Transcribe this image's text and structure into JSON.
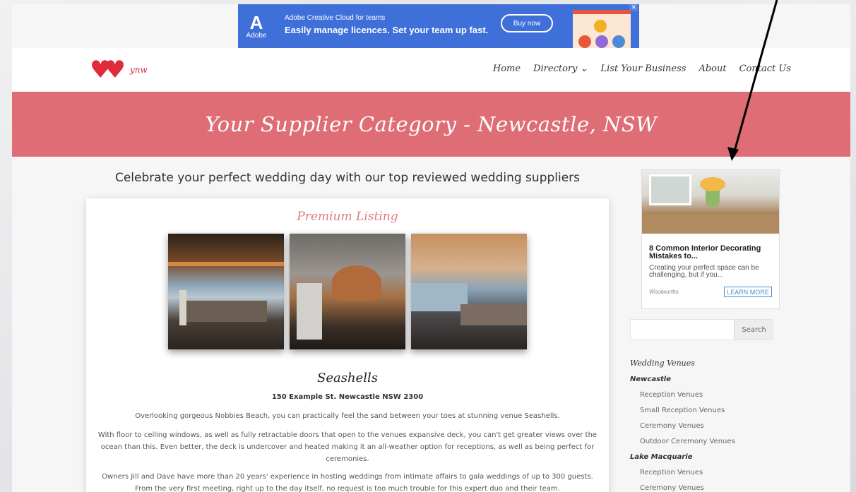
{
  "top_ad": {
    "logo_text": "Adobe",
    "line1": "Adobe Creative Cloud for teams",
    "line2": "Easily manage licences. Set your team up fast.",
    "button": "Buy now"
  },
  "header": {
    "brand_name": "ynw",
    "nav": [
      "Home",
      "Directory ⌄",
      "List Your Business",
      "About",
      "Contact Us"
    ]
  },
  "hero": {
    "title": "Your Supplier Category - Newcastle, NSW"
  },
  "main": {
    "tagline": "Celebrate your perfect wedding day with our top reviewed wedding suppliers",
    "listing": {
      "badge": "Premium Listing",
      "name": "Seashells",
      "address": "150 Example St. Newcastle NSW 2300",
      "paragraphs": [
        "Overlooking gorgeous Nobbies Beach, you can practically feel the sand between your toes at stunning venue Seashells.",
        "With floor to ceiling windows, as well as fully retractable doors that open to the venues expansive deck, you can't get greater views over the ocean than this. Even better, the deck is undercover and heated making it an all-weather option for receptions, as well as being perfect for ceremonies.",
        "Owners Jill and Dave have more than 20 years' experience in hosting weddings from intimate affairs to gala weddings of up to 300 guests. From the very first meeting, right up to the day itself, no request is too much trouble for this expert duo and their team."
      ]
    }
  },
  "sidebar": {
    "ad": {
      "title": "8 Common Interior Decorating Mistakes to...",
      "description": "Creating your perfect space can be challenging, but if you...",
      "sponsor": "Woolworths",
      "cta": "LEARN MORE"
    },
    "search": {
      "button": "Search",
      "placeholder": ""
    },
    "category": "Wedding Venues",
    "regions": [
      {
        "name": "Newcastle",
        "items": [
          "Reception Venues",
          "Small Reception Venues",
          "Ceremony Venues",
          "Outdoor Ceremony Venues"
        ]
      },
      {
        "name": "Lake Macquarie",
        "items": [
          "Reception Venues",
          "Ceremony Venues"
        ]
      }
    ]
  },
  "colors": {
    "banner": "#df6d76",
    "brand_red": "#e02b3b",
    "ad_blue": "#3f6fd9",
    "premium_pink": "#e07a80"
  }
}
